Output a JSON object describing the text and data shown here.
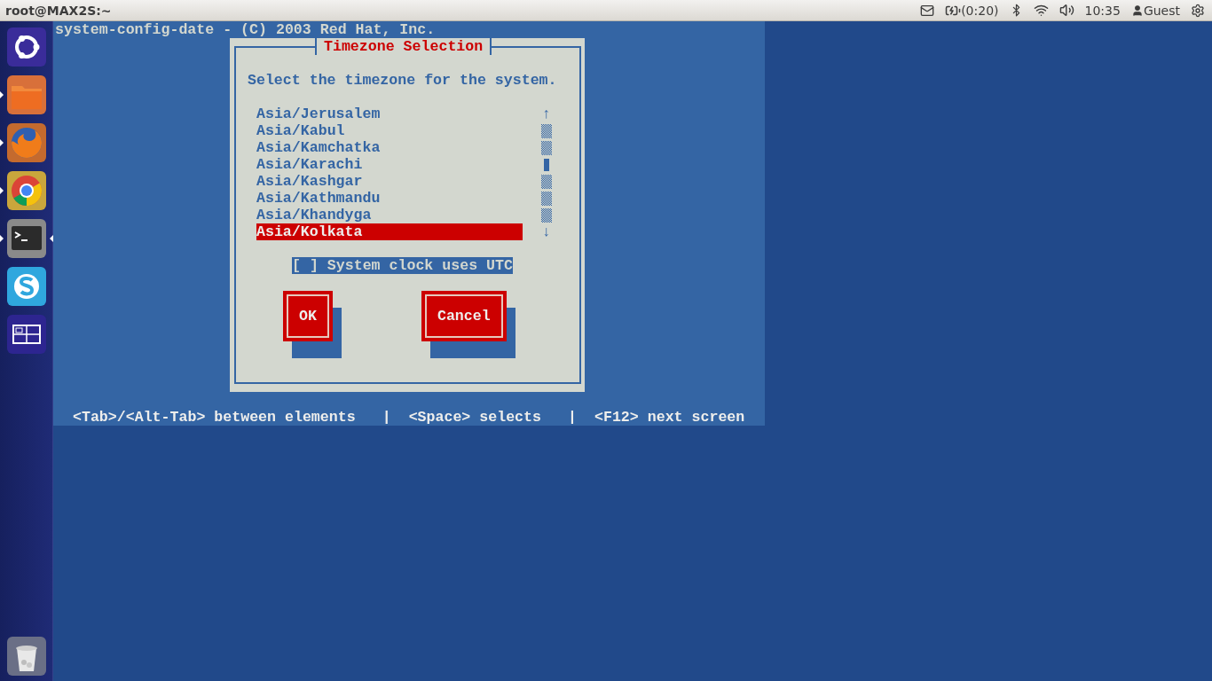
{
  "top_panel": {
    "title": "root@MAX2S:~",
    "battery": "(0:20)",
    "clock": "10:35",
    "user": "Guest"
  },
  "launcher": {
    "items": [
      {
        "kind": "home",
        "running": false,
        "focused": false
      },
      {
        "kind": "files",
        "running": true,
        "focused": false
      },
      {
        "kind": "firefox",
        "running": true,
        "focused": false
      },
      {
        "kind": "chrome",
        "running": true,
        "focused": false
      },
      {
        "kind": "terminal",
        "running": true,
        "focused": true
      },
      {
        "kind": "skype",
        "running": false,
        "focused": false
      },
      {
        "kind": "workspaces",
        "running": false,
        "focused": false
      }
    ],
    "trash": {
      "kind": "trash"
    }
  },
  "terminal": {
    "header": "system-config-date - (C) 2003 Red Hat, Inc.",
    "dialog": {
      "title": "Timezone Selection",
      "prompt": "Select the timezone for the system.",
      "items": [
        {
          "label": "Asia/Jerusalem",
          "selected": false
        },
        {
          "label": "Asia/Kabul",
          "selected": false
        },
        {
          "label": "Asia/Kamchatka",
          "selected": false
        },
        {
          "label": "Asia/Karachi",
          "selected": false
        },
        {
          "label": "Asia/Kashgar",
          "selected": false
        },
        {
          "label": "Asia/Kathmandu",
          "selected": false
        },
        {
          "label": "Asia/Khandyga",
          "selected": false
        },
        {
          "label": "Asia/Kolkata",
          "selected": true
        }
      ],
      "scrollbar": {
        "up": "↑",
        "down": "↓"
      },
      "checkbox": {
        "label": "[ ] System clock uses UTC",
        "focused": true
      },
      "buttons": [
        {
          "label": "OK"
        },
        {
          "label": "Cancel"
        }
      ]
    },
    "help": [
      {
        "kind": "hint",
        "text": "<Tab>/<Alt-Tab> between elements"
      },
      {
        "kind": "separator",
        "text": "|"
      },
      {
        "kind": "hint",
        "text": "<Space> selects"
      },
      {
        "kind": "separator",
        "text": "|"
      },
      {
        "kind": "hint",
        "text": "<F12> next screen"
      }
    ]
  }
}
